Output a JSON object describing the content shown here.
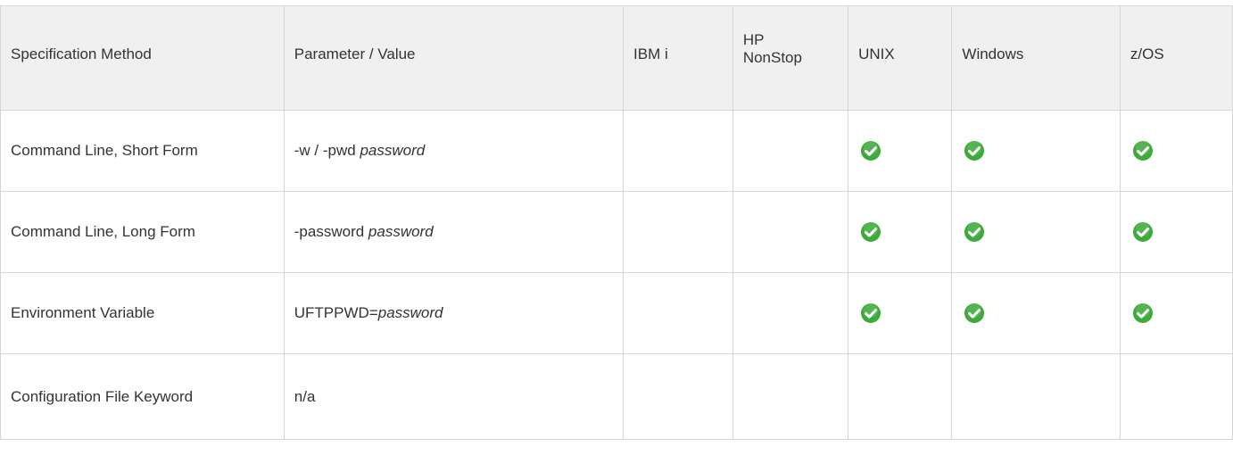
{
  "headers": {
    "spec_method": "Specification Method",
    "param_value": "Parameter / Value",
    "ibm_i": "IBM i",
    "hp_nonstop_line1": "HP",
    "hp_nonstop_line2": "NonStop",
    "unix": "UNIX",
    "windows": "Windows",
    "zos": "z/OS"
  },
  "rows": [
    {
      "method": "Command Line, Short Form",
      "param_prefix": "-w / -pwd ",
      "param_italic": "password",
      "ibm_i": false,
      "hp_nonstop": false,
      "unix": true,
      "windows": true,
      "zos": true
    },
    {
      "method": "Command Line, Long Form",
      "param_prefix": "-password ",
      "param_italic": "password",
      "ibm_i": false,
      "hp_nonstop": false,
      "unix": true,
      "windows": true,
      "zos": true
    },
    {
      "method": "Environment Variable",
      "param_prefix": "UFTPPWD=",
      "param_italic": "password",
      "ibm_i": false,
      "hp_nonstop": false,
      "unix": true,
      "windows": true,
      "zos": true
    },
    {
      "method": "Configuration File Keyword",
      "param_prefix": "n/a",
      "param_italic": "",
      "ibm_i": false,
      "hp_nonstop": false,
      "unix": false,
      "windows": false,
      "zos": false
    }
  ],
  "colors": {
    "header_bg": "#f0f0f0",
    "border": "#d6d6d6",
    "check_green": "#3daa3a"
  },
  "icons": {
    "supported": "green-check-circle-icon"
  }
}
